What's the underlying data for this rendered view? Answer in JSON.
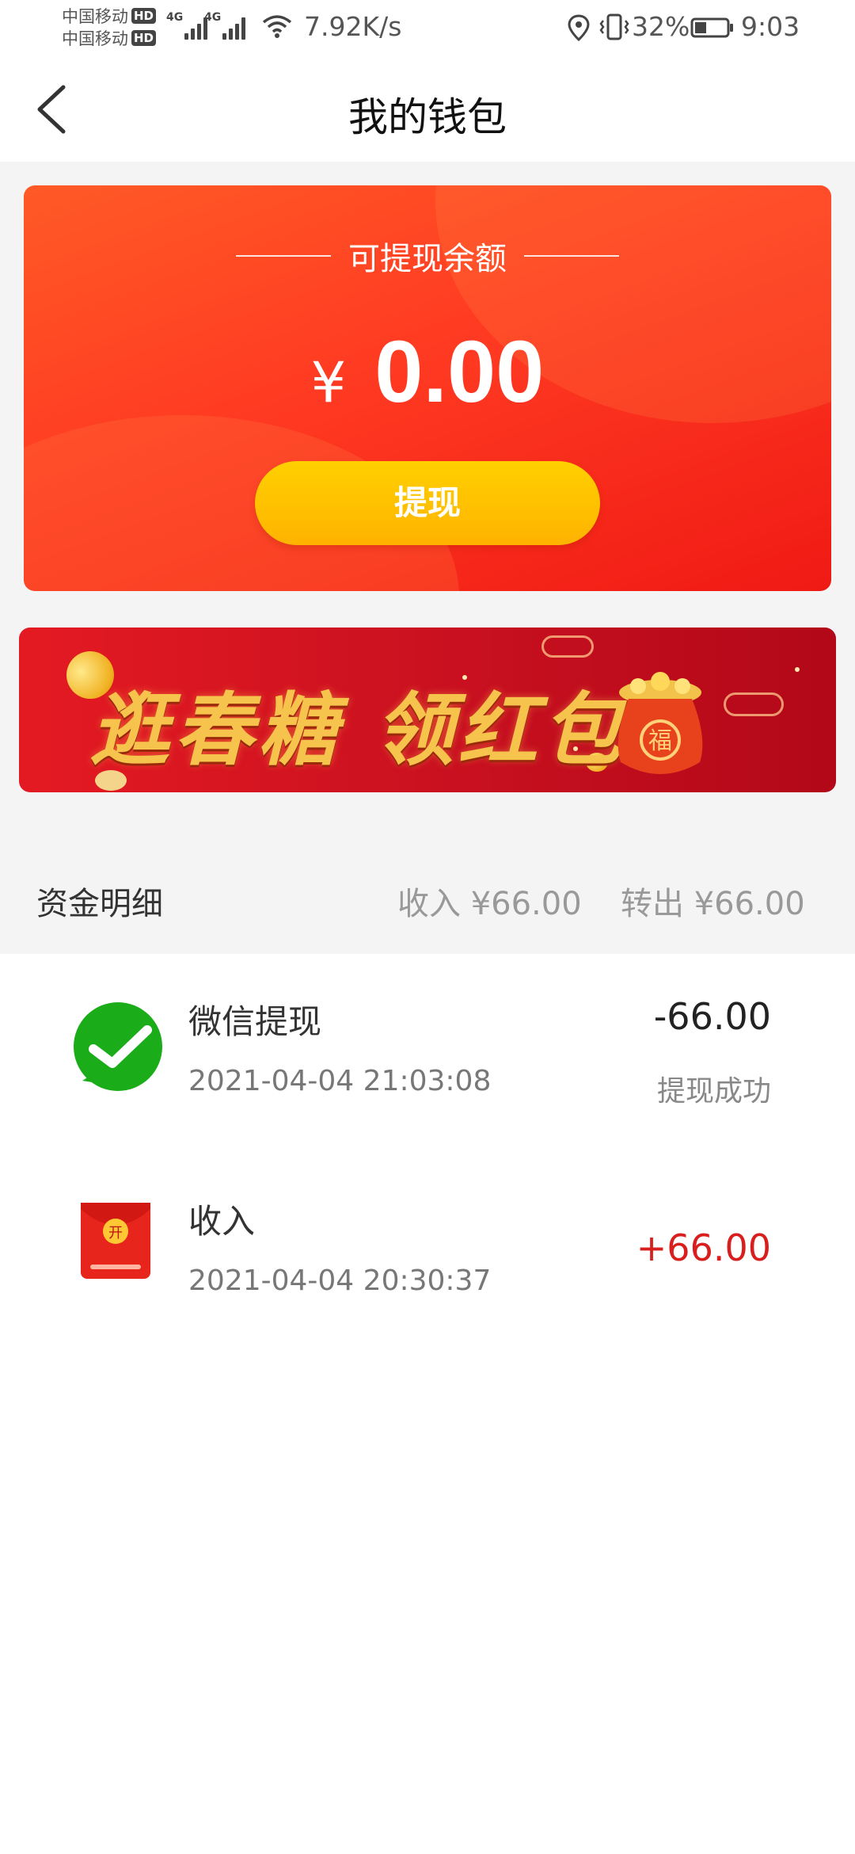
{
  "status_bar": {
    "carrier_1": "中国移动",
    "carrier_2": "中国移动",
    "hd_label": "HD",
    "network_tag": "4G",
    "net_speed": "7.92K/s",
    "battery": "32%",
    "time": "9:03"
  },
  "nav": {
    "title": "我的钱包",
    "back_icon": "chevron-left-icon"
  },
  "balance_card": {
    "label": "可提现余额",
    "currency": "¥",
    "amount": "0.00",
    "withdraw_label": "提现"
  },
  "banner": {
    "text": "逛春糖 领红包",
    "bag_badge": "福"
  },
  "funds": {
    "title": "资金明细",
    "income_summary": "收入 ¥66.00",
    "out_summary": "转出 ¥66.00"
  },
  "transactions": [
    {
      "icon": "wechat-icon",
      "title": "微信提现",
      "date": "2021-04-04 21:03:08",
      "amount": "-66.00",
      "status": "提现成功"
    },
    {
      "icon": "red-envelope-icon",
      "title": "收入",
      "date": "2021-04-04 20:30:37",
      "amount": "+66.00",
      "status": ""
    }
  ],
  "colors": {
    "card_gradient_start": "#ff5a26",
    "card_gradient_end": "#f01a14",
    "button_yellow": "#ffc000",
    "positive_amount": "#d91e1e",
    "wechat_green": "#1aad19"
  }
}
